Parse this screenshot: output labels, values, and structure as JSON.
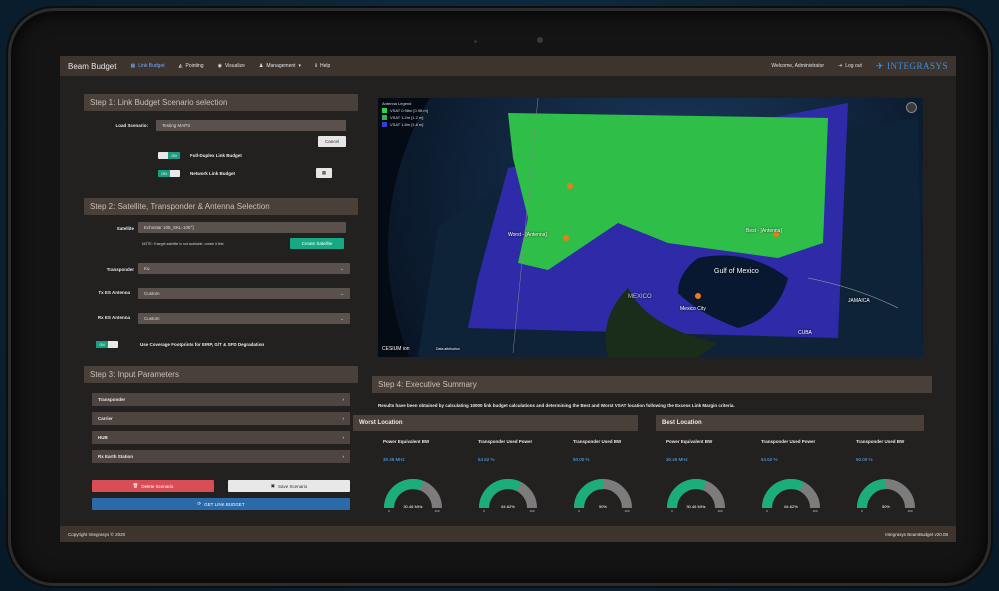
{
  "nav": {
    "brand": "Beam Budget",
    "items": [
      {
        "label": "Link Budget",
        "icon": "grid-icon",
        "active": true
      },
      {
        "label": "Pointing",
        "icon": "dish-icon",
        "active": false
      },
      {
        "label": "Visualize",
        "icon": "globe-icon",
        "active": false
      },
      {
        "label": "Management",
        "icon": "user-icon",
        "active": false
      },
      {
        "label": "Help",
        "icon": "info-icon",
        "active": false
      }
    ],
    "welcome": "Welcome, Administrator",
    "logout": "Log out",
    "logo": "INTEGRASYS"
  },
  "step1": {
    "header": "Step 1: Link Budget Scenario selection",
    "load_label": "Load Scenario:",
    "load_value": "Testing MAPS",
    "cancel": "Cancel",
    "full_duplex_label": "Full-Duplex Link Budget",
    "network_label": "Network Link Budget",
    "toggle_on": "ON"
  },
  "step2": {
    "header": "Step 2: Satellite, Transponder & Antenna Selection",
    "satellite_label": "Satellite",
    "satellite_value": "Echostar 105_SKL-105°]",
    "note": "NOTE: If target satellite is not available, create it first.",
    "create_button": "Create Satellite",
    "transponder_label": "Transponder",
    "transponder_value": "Ku",
    "tx_label": "Tx ES Antenna",
    "tx_value": "Custom",
    "rx_label": "Rx ES Antenna",
    "rx_value": "Custom",
    "coverage_label": "Use Coverage Footprints for EIRP, G/T & SFD Degradation"
  },
  "step3": {
    "header": "Step 3: Input Parameters",
    "items": [
      "Transponder",
      "Carrier",
      "HUB",
      "Rx Earth Station"
    ],
    "delete": "Delete Scenario",
    "save": "Save Scenario",
    "get": "GET LINK BUDGET"
  },
  "map": {
    "legend_title": "Antenna Legend",
    "legend": [
      {
        "label": "VSAT 0.98m [0.98 m]",
        "color": "#2bd44c"
      },
      {
        "label": "VSAT 1.2m [1.2 m]",
        "color": "#2fb84a"
      },
      {
        "label": "VSAT 1.8m [1.8 m]",
        "color": "#3b3bd0"
      }
    ],
    "worst_label": "Worst - [Antenna]",
    "best_label": "Best - [Antenna]",
    "gulf_label": "Gulf of Mexico",
    "mexico_label": "MEXICO",
    "city_label": "Mexico City",
    "cuba_label": "CUBA",
    "jamaica_label": "JAMAICA",
    "cesium": "CESIUM ion",
    "data_attr": "Data attribution"
  },
  "step4": {
    "header": "Step 4: Executive Summary",
    "summary": "Results have been obtained by calculating 10000 link budget calculations and determining the Best and Worst VSAT location following the Excess Link Margin criteria.",
    "worst": {
      "title": "Worst Location",
      "metrics": [
        {
          "title": "Power Equivalent BW",
          "value": "30.46 MHz",
          "gauge": "30.46 MHz",
          "fraction": 0.62
        },
        {
          "title": "Transponder Used Power",
          "value": "64.62 %",
          "gauge": "64.62%",
          "fraction": 0.65
        },
        {
          "title": "Transponder Used BW",
          "value": "50.00 %",
          "gauge": "50%",
          "fraction": 0.5
        }
      ]
    },
    "best": {
      "title": "Best Location",
      "metrics": [
        {
          "title": "Power Equivalent BW",
          "value": "30.46 MHz",
          "gauge": "30.46 MHz",
          "fraction": 0.62
        },
        {
          "title": "Transponder Used Power",
          "value": "64.62 %",
          "gauge": "64.62%",
          "fraction": 0.65
        },
        {
          "title": "Transponder Used BW",
          "value": "50.00 %",
          "gauge": "50%",
          "fraction": 0.5
        }
      ]
    },
    "gauge_min": "0",
    "gauge_max": "100"
  },
  "footer": {
    "copyright": "Copyright Integrasys © 2020",
    "version": "Integrasys BeamBudget v20.08"
  }
}
